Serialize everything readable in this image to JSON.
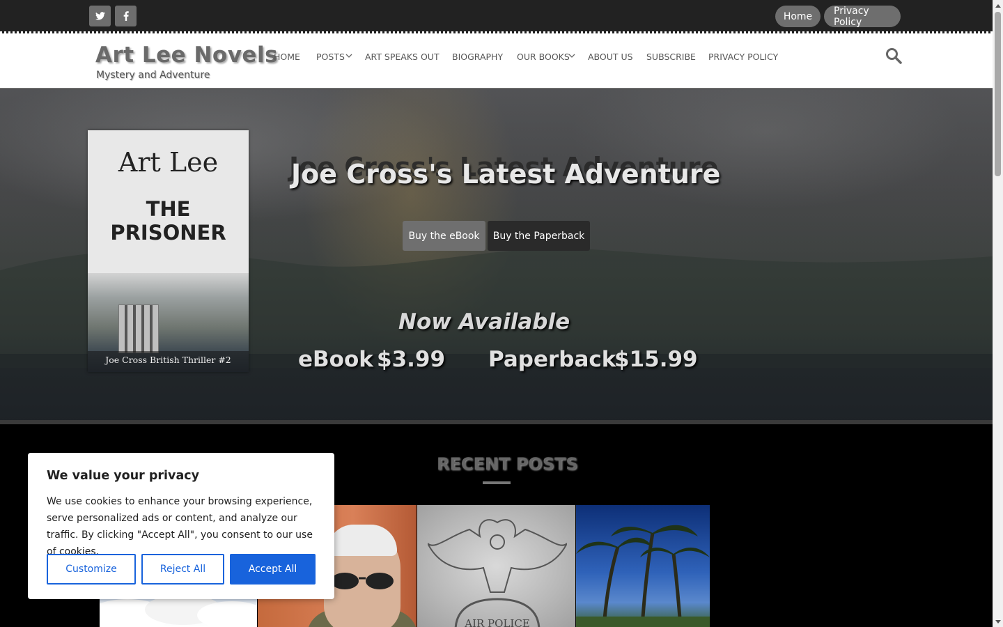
{
  "topbar": {
    "social": [
      {
        "icon": "twitter-icon",
        "glyph": "🐦"
      },
      {
        "icon": "facebook-icon",
        "glyph": "f"
      }
    ],
    "links": [
      {
        "label": "Home"
      },
      {
        "label": "Privacy Policy"
      }
    ]
  },
  "header": {
    "site_title": "Art Lee Novels",
    "tagline": "Mystery and Adventure",
    "nav": [
      {
        "label": "HOME"
      },
      {
        "label": "POSTS"
      },
      {
        "label": "ART SPEAKS OUT"
      },
      {
        "label": "BIOGRAPHY"
      },
      {
        "label": "OUR BOOKS"
      },
      {
        "label": "ABOUT US"
      },
      {
        "label": "SUBSCRIBE"
      },
      {
        "label": "PRIVACY POLICY"
      }
    ]
  },
  "hero": {
    "cover_author": "Art Lee",
    "cover_title_line1": "THE",
    "cover_title_line2": "PRISONER",
    "cover_subtitle": "Joe Cross British Thriller #2",
    "title": "Joe Cross's Latest Adventure",
    "buttons": {
      "ebook": "Buy the eBook",
      "paperback": "Buy the Paperback"
    },
    "now_available": "Now Available",
    "prices": {
      "ebook_label": "eBook",
      "ebook_price": "$3.99",
      "paperback_label": "Paperback",
      "paperback_price": "$15.99"
    }
  },
  "recent_posts": {
    "heading": "RECENT POSTS",
    "emblem_text": "AIR POLICE"
  },
  "cookie": {
    "title": "We value your privacy",
    "text": "We use cookies to enhance your browsing experience, serve personalized ads or content, and analyze our traffic. By clicking \"Accept All\", you consent to our use of cookies.",
    "buttons": {
      "customize": "Customize",
      "reject": "Reject All",
      "accept": "Accept All"
    },
    "accent_color": "#1863dc"
  },
  "colors": {
    "topbar_bg": "#222222",
    "pill_bg": "#6e6e6e",
    "nav_text": "#555555"
  }
}
